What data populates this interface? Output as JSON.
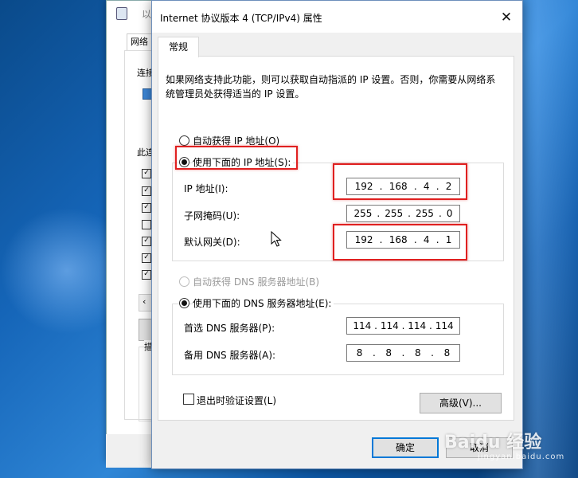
{
  "dialog": {
    "title": "Internet 协议版本 4 (TCP/IPv4) 属性",
    "tab": "常规",
    "description": "如果网络支持此功能，则可以获取自动指派的 IP 设置。否则，你需要从网络系统管理员处获得适当的 IP 设置。",
    "ip_section": {
      "auto_radio": "自动获得 IP 地址(O)",
      "manual_radio": "使用下面的 IP 地址(S):",
      "selected": "manual",
      "ip_label": "IP 地址(I):",
      "ip_value": [
        "192",
        "168",
        "4",
        "2"
      ],
      "mask_label": "子网掩码(U):",
      "mask_value": [
        "255",
        "255",
        "255",
        "0"
      ],
      "gateway_label": "默认网关(D):",
      "gateway_value": [
        "192",
        "168",
        "4",
        "1"
      ]
    },
    "dns_section": {
      "auto_radio": "自动获得 DNS 服务器地址(B)",
      "manual_radio": "使用下面的 DNS 服务器地址(E):",
      "selected": "manual",
      "preferred_label": "首选 DNS 服务器(P):",
      "preferred_value": [
        "114",
        "114",
        "114",
        "114"
      ],
      "alternate_label": "备用 DNS 服务器(A):",
      "alternate_value": [
        "8",
        "8",
        "8",
        "8"
      ]
    },
    "validate_checkbox": "退出时验证设置(L)",
    "advanced_button": "高级(V)...",
    "ok_button": "确定",
    "cancel_button": "取消"
  },
  "back_window": {
    "title_fragment": "以",
    "tab_fragment": "网络",
    "label_connect": "连接",
    "label_this": "此连",
    "label_desc": "描"
  },
  "watermark": {
    "logo": "Baidu 经验",
    "url": "jingyan.baidu.com"
  },
  "colors": {
    "highlight": "#e02020",
    "accent": "#0078d7"
  }
}
